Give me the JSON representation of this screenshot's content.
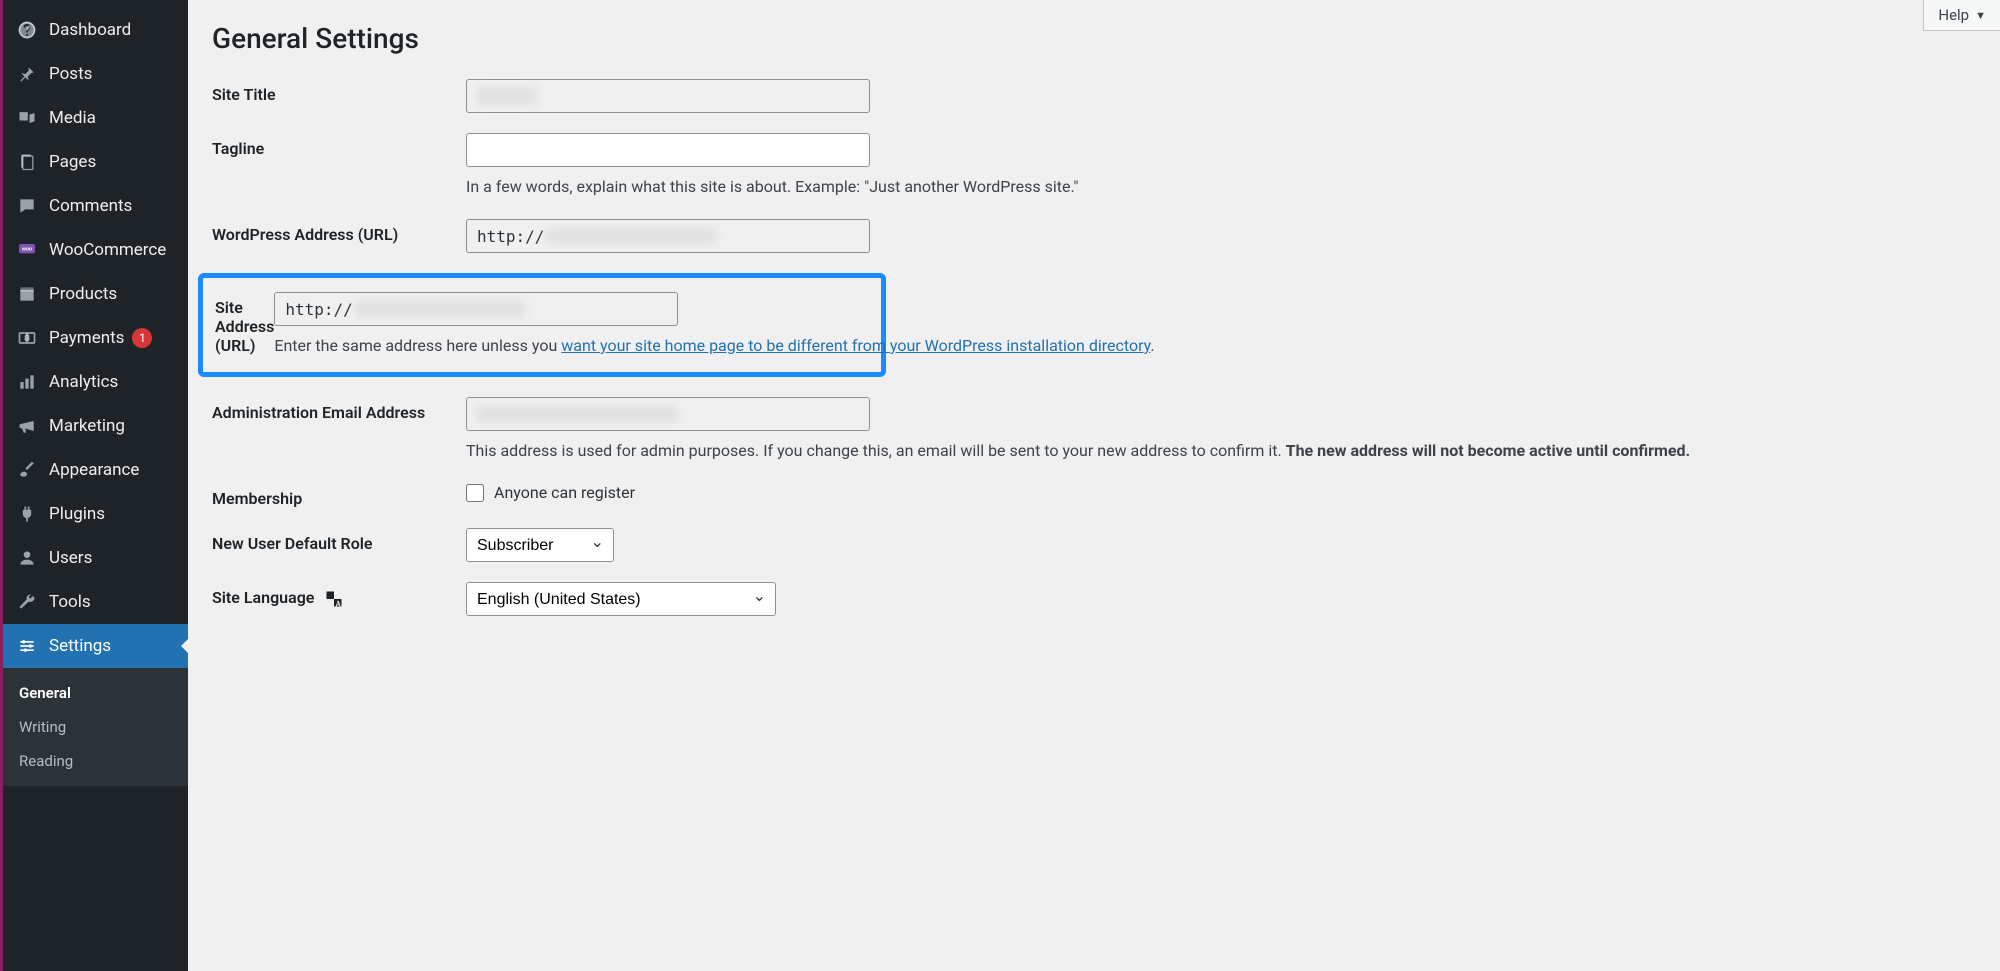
{
  "sidebar": {
    "items": [
      {
        "id": "dashboard",
        "label": "Dashboard"
      },
      {
        "id": "posts",
        "label": "Posts"
      },
      {
        "id": "media",
        "label": "Media"
      },
      {
        "id": "pages",
        "label": "Pages"
      },
      {
        "id": "comments",
        "label": "Comments"
      },
      {
        "id": "woocommerce",
        "label": "WooCommerce"
      },
      {
        "id": "products",
        "label": "Products"
      },
      {
        "id": "payments",
        "label": "Payments",
        "badge": "1"
      },
      {
        "id": "analytics",
        "label": "Analytics"
      },
      {
        "id": "marketing",
        "label": "Marketing"
      },
      {
        "id": "appearance",
        "label": "Appearance"
      },
      {
        "id": "plugins",
        "label": "Plugins"
      },
      {
        "id": "users",
        "label": "Users"
      },
      {
        "id": "tools",
        "label": "Tools"
      },
      {
        "id": "settings",
        "label": "Settings"
      }
    ],
    "submenu": {
      "items": [
        "General",
        "Writing",
        "Reading"
      ],
      "current": "General"
    }
  },
  "header": {
    "help": "Help"
  },
  "page": {
    "title": "General Settings",
    "site_title_label": "Site Title",
    "tagline_label": "Tagline",
    "tagline_help": "In a few words, explain what this site is about. Example: \"Just another WordPress site.\"",
    "wp_address_label": "WordPress Address (URL)",
    "wp_address_value": "http://",
    "site_address_label": "Site Address (URL)",
    "site_address_value": "http://",
    "site_address_help_pre": "Enter the same address here unless you ",
    "site_address_help_link": "want your site home page to be different from your WordPress installation directory",
    "site_address_help_post": ".",
    "admin_email_label": "Administration Email Address",
    "admin_email_help_pre": "This address is used for admin purposes. If you change this, an email will be sent to your new address to confirm it. ",
    "admin_email_help_strong": "The new address will not become active until confirmed.",
    "membership_label": "Membership",
    "membership_option": "Anyone can register",
    "default_role_label": "New User Default Role",
    "default_role_value": "Subscriber",
    "site_language_label": "Site Language",
    "site_language_value": "English (United States)"
  }
}
